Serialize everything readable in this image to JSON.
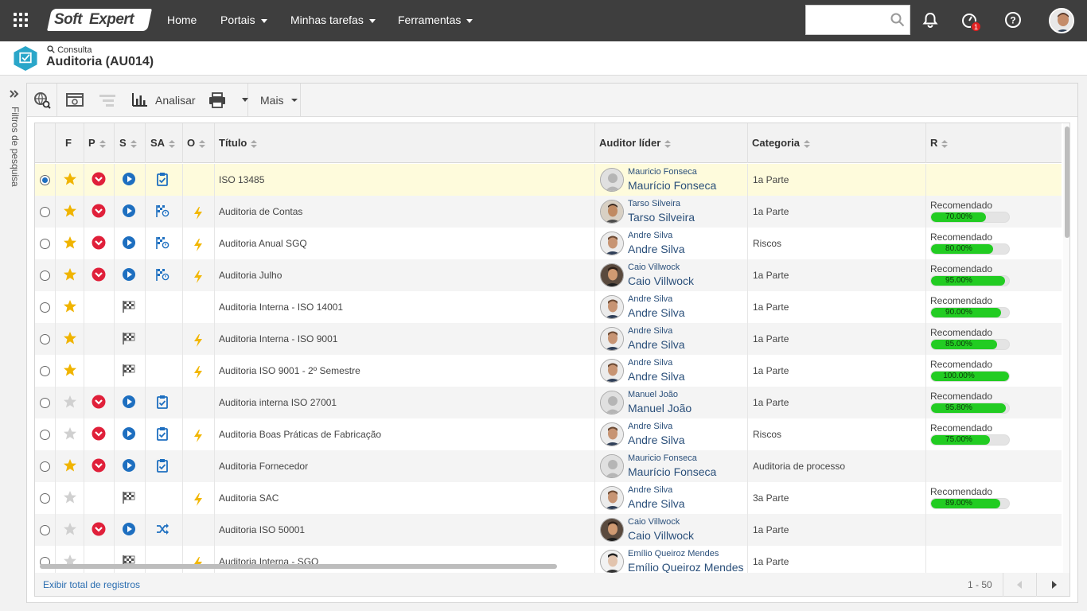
{
  "topbar": {
    "brand_part1": "Soft",
    "brand_part2": "Expert",
    "nav": [
      {
        "label": "Home"
      },
      {
        "label": "Portais"
      },
      {
        "label": "Minhas tarefas"
      },
      {
        "label": "Ferramentas"
      }
    ],
    "search_value": "",
    "notification_badge": "1"
  },
  "header": {
    "breadcrumb": "Consulta",
    "title": "Auditoria (AU014)"
  },
  "sidebar": {
    "filters_label": "Filtros de pesquisa"
  },
  "toolbar": {
    "analyze_label": "Analisar",
    "more_label": "Mais"
  },
  "table": {
    "columns": [
      "F",
      "P",
      "S",
      "SA",
      "O",
      "Título",
      "Auditor líder",
      "Categoria",
      "R"
    ],
    "rows": [
      {
        "selected": true,
        "fav": true,
        "p": true,
        "s": "play",
        "sa": "clip",
        "o": false,
        "title": "ISO 13485",
        "auditor_small": "Mauricio Fonseca",
        "auditor": "Maurício Fonseca",
        "photo": "generic",
        "category": "1a Parte",
        "r_label": "",
        "r_value": null,
        "r_text": ""
      },
      {
        "selected": false,
        "fav": true,
        "p": true,
        "s": "play",
        "sa": "flag",
        "o": true,
        "title": "Auditoria de Contas",
        "auditor_small": "Tarso Silveira",
        "auditor": "Tarso Silveira",
        "photo": "tarso",
        "category": "1a Parte",
        "r_label": "Recomendado",
        "r_value": 70,
        "r_text": "70.00%"
      },
      {
        "selected": false,
        "fav": true,
        "p": true,
        "s": "play",
        "sa": "flag",
        "o": true,
        "title": "Auditoria Anual SGQ",
        "auditor_small": "Andre Silva",
        "auditor": "Andre Silva",
        "photo": "andre",
        "category": "Riscos",
        "r_label": "Recomendado",
        "r_value": 80,
        "r_text": "80.00%"
      },
      {
        "selected": false,
        "fav": true,
        "p": true,
        "s": "play",
        "sa": "flag",
        "o": true,
        "title": "Auditoria Julho",
        "auditor_small": "Caio Villwock",
        "auditor": "Caio Villwock",
        "photo": "caio",
        "category": "1a Parte",
        "r_label": "Recomendado",
        "r_value": 95,
        "r_text": "95.00%"
      },
      {
        "selected": false,
        "fav": true,
        "p": false,
        "s": "checker",
        "sa": "",
        "o": false,
        "title": "Auditoria Interna - ISO 14001",
        "auditor_small": "Andre Silva",
        "auditor": "Andre Silva",
        "photo": "andre",
        "category": "1a Parte",
        "r_label": "Recomendado",
        "r_value": 90,
        "r_text": "90.00%"
      },
      {
        "selected": false,
        "fav": true,
        "p": false,
        "s": "checker",
        "sa": "",
        "o": true,
        "title": "Auditoria Interna - ISO 9001",
        "auditor_small": "Andre Silva",
        "auditor": "Andre Silva",
        "photo": "andre",
        "category": "1a Parte",
        "r_label": "Recomendado",
        "r_value": 85,
        "r_text": "85.00%"
      },
      {
        "selected": false,
        "fav": true,
        "p": false,
        "s": "checker",
        "sa": "",
        "o": true,
        "title": "Auditoria ISO 9001 - 2º Semestre",
        "auditor_small": "Andre Silva",
        "auditor": "Andre Silva",
        "photo": "andre",
        "category": "1a Parte",
        "r_label": "Recomendado",
        "r_value": 100,
        "r_text": "100.00%"
      },
      {
        "selected": false,
        "fav": false,
        "p": true,
        "s": "play",
        "sa": "clip",
        "o": false,
        "title": "Auditoria interna ISO 27001",
        "auditor_small": "Manuel João",
        "auditor": "Manuel João",
        "photo": "generic",
        "category": "1a Parte",
        "r_label": "Recomendado",
        "r_value": 95.8,
        "r_text": "95.80%"
      },
      {
        "selected": false,
        "fav": false,
        "p": true,
        "s": "play",
        "sa": "clip",
        "o": true,
        "title": "Auditoria Boas Práticas de Fabricação",
        "auditor_small": "Andre Silva",
        "auditor": "Andre Silva",
        "photo": "andre",
        "category": "Riscos",
        "r_label": "Recomendado",
        "r_value": 75,
        "r_text": "75.00%"
      },
      {
        "selected": false,
        "fav": true,
        "p": true,
        "s": "play",
        "sa": "clip",
        "o": false,
        "title": "Auditoria Fornecedor",
        "auditor_small": "Mauricio Fonseca",
        "auditor": "Maurício Fonseca",
        "photo": "generic",
        "category": "Auditoria de processo",
        "r_label": "",
        "r_value": null,
        "r_text": ""
      },
      {
        "selected": false,
        "fav": false,
        "p": false,
        "s": "checker",
        "sa": "",
        "o": true,
        "title": "Auditoria SAC",
        "auditor_small": "Andre Silva",
        "auditor": "Andre Silva",
        "photo": "andre",
        "category": "3a Parte",
        "r_label": "Recomendado",
        "r_value": 89,
        "r_text": "89.00%"
      },
      {
        "selected": false,
        "fav": false,
        "p": true,
        "s": "play",
        "sa": "cross",
        "o": false,
        "title": "Auditoria ISO 50001",
        "auditor_small": "Caio Villwock",
        "auditor": "Caio Villwock",
        "photo": "caio",
        "category": "1a Parte",
        "r_label": "",
        "r_value": null,
        "r_text": ""
      },
      {
        "selected": false,
        "fav": false,
        "p": false,
        "s": "checker",
        "sa": "",
        "o": true,
        "title": "Auditoria Interna - SGQ",
        "auditor_small": "Emílio Queiroz Mendes",
        "auditor": "Emílio Queiroz Mendes",
        "photo": "emilio",
        "category": "1a Parte",
        "r_label": "",
        "r_value": null,
        "r_text": ""
      }
    ]
  },
  "footer": {
    "total_link": "Exibir total de registros",
    "paging": "1 - 50"
  },
  "colors": {
    "topbar": "#3e3e3e",
    "selected_row": "#fefbdc",
    "progress": "#22cc22",
    "link": "#2a6db0"
  }
}
